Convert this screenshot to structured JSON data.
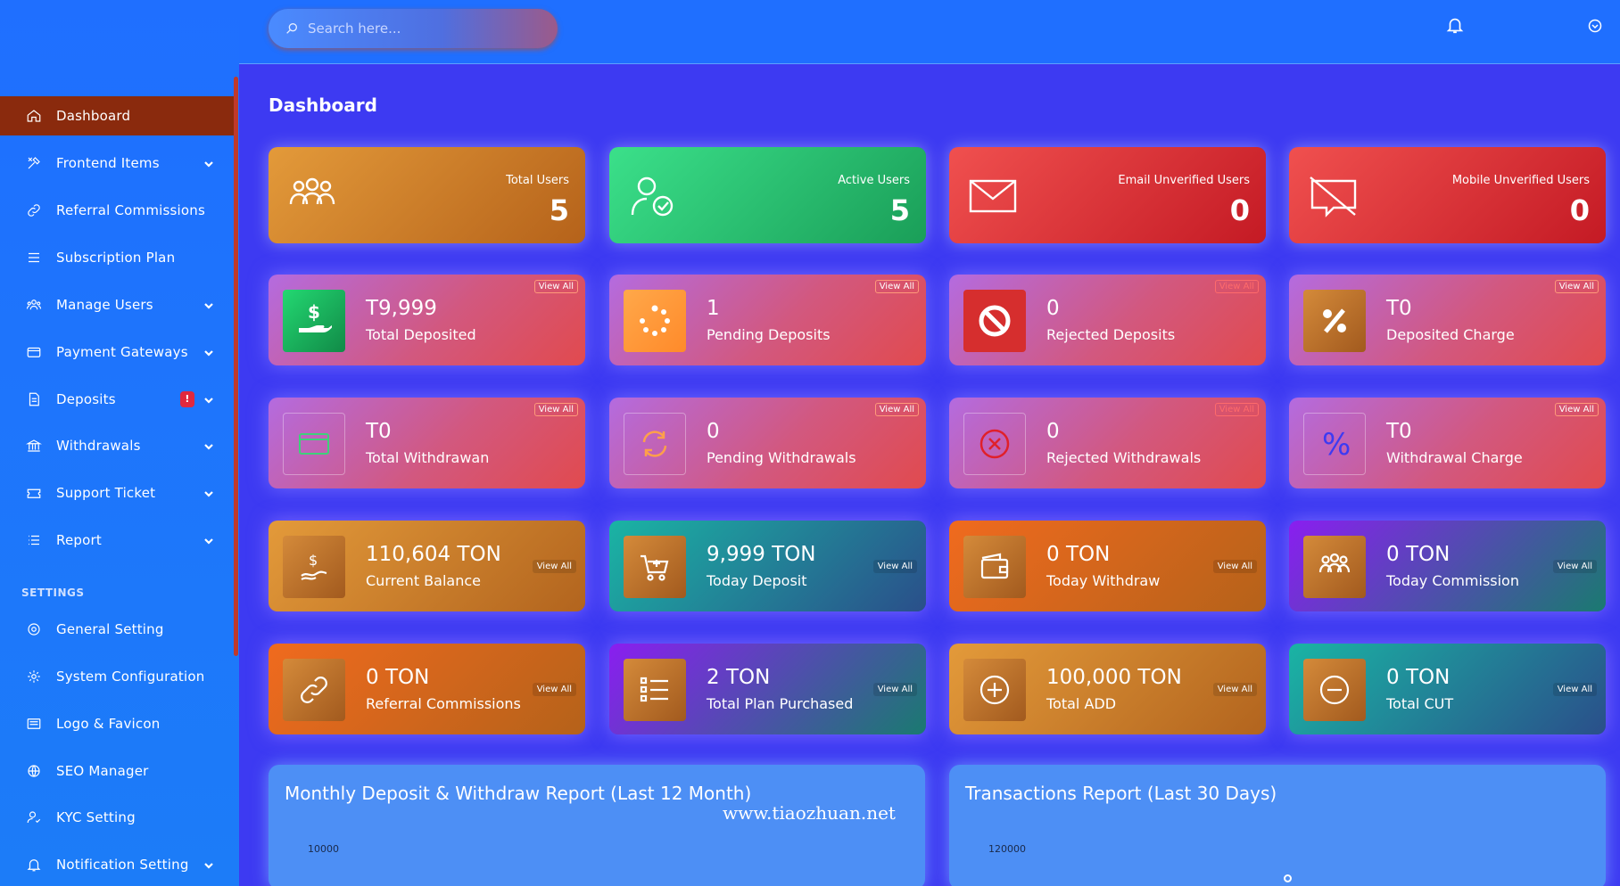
{
  "search": {
    "placeholder": "Search here..."
  },
  "page": {
    "title": "Dashboard"
  },
  "sidebar": {
    "items": [
      {
        "label": "Dashboard"
      },
      {
        "label": "Frontend Items"
      },
      {
        "label": "Referral Commissions"
      },
      {
        "label": "Subscription Plan"
      },
      {
        "label": "Manage Users"
      },
      {
        "label": "Payment Gateways"
      },
      {
        "label": "Deposits",
        "badge": "!"
      },
      {
        "label": "Withdrawals"
      },
      {
        "label": "Support Ticket"
      },
      {
        "label": "Report"
      }
    ],
    "settings_title": "SETTINGS",
    "settings_items": [
      {
        "label": "General Setting"
      },
      {
        "label": "System Configuration"
      },
      {
        "label": "Logo & Favicon"
      },
      {
        "label": "SEO Manager"
      },
      {
        "label": "KYC Setting"
      },
      {
        "label": "Notification Setting"
      }
    ]
  },
  "top_cards": [
    {
      "label": "Total Users",
      "value": "5",
      "color": "#d98a2e"
    },
    {
      "label": "Active Users",
      "value": "5",
      "color": "#2ecf7a"
    },
    {
      "label": "Email Unverified Users",
      "value": "0",
      "color": "#e0343a"
    },
    {
      "label": "Mobile Unverified Users",
      "value": "0",
      "color": "#e0343a"
    }
  ],
  "deposit_cards": [
    {
      "value": "T9,999",
      "label": "Total Deposited",
      "view": "View All",
      "icon": "hand-dollar-icon"
    },
    {
      "value": "1",
      "label": "Pending Deposits",
      "view": "View All",
      "icon": "spinner-icon"
    },
    {
      "value": "0",
      "label": "Rejected Deposits",
      "view": "View All",
      "icon": "ban-icon"
    },
    {
      "value": "T0",
      "label": "Deposited Charge",
      "view": "View All",
      "icon": "percent-icon"
    }
  ],
  "withdraw_cards": [
    {
      "value": "T0",
      "label": "Total Withdrawan",
      "view": "View All",
      "icon": "card-icon"
    },
    {
      "value": "0",
      "label": "Pending Withdrawals",
      "view": "View All",
      "icon": "refresh-icon"
    },
    {
      "value": "0",
      "label": "Rejected Withdrawals",
      "view": "View All",
      "icon": "x-circle-icon"
    },
    {
      "value": "T0",
      "label": "Withdrawal Charge",
      "view": "View All",
      "icon": "percent-icon"
    }
  ],
  "balance_cards": [
    {
      "value": "110,604 TON",
      "label": "Current Balance",
      "view": "View All"
    },
    {
      "value": "9,999 TON",
      "label": "Today Deposit",
      "view": "View All"
    },
    {
      "value": "0 TON",
      "label": "Today Withdraw",
      "view": "View All"
    },
    {
      "value": "0 TON",
      "label": "Today Commission",
      "view": "View All"
    }
  ],
  "misc_cards": [
    {
      "value": "0 TON",
      "label": "Referral Commissions",
      "view": "View All"
    },
    {
      "value": "2 TON",
      "label": "Total Plan Purchased",
      "view": "View All"
    },
    {
      "value": "100,000 TON",
      "label": "Total ADD",
      "view": "View All"
    },
    {
      "value": "0 TON",
      "label": "Total CUT",
      "view": "View All"
    }
  ],
  "charts": [
    {
      "title": "Monthly Deposit & Withdraw Report (Last 12 Month)",
      "tick": "10000"
    },
    {
      "title": "Transactions Report (Last 30 Days)",
      "tick": "120000"
    }
  ],
  "watermark": "www.tiaozhuan.net"
}
